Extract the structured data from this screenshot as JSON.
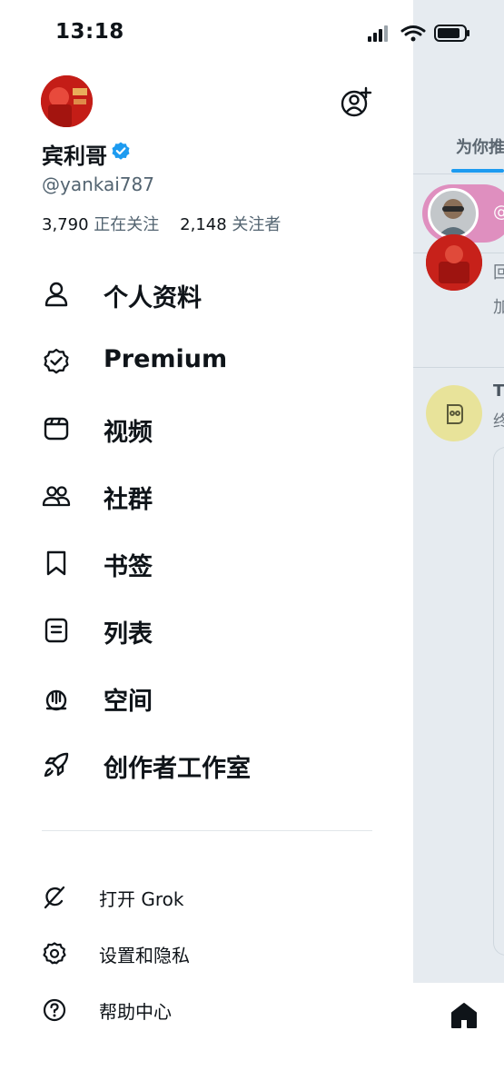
{
  "status_bar": {
    "time": "13:18"
  },
  "profile": {
    "display_name": "宾利哥",
    "handle": "@yankai787",
    "following_count": "3,790",
    "following_label": "正在关注",
    "followers_count": "2,148",
    "followers_label": "关注者"
  },
  "menu": {
    "items": [
      {
        "label": "个人资料",
        "icon": "person-icon"
      },
      {
        "label": "Premium",
        "icon": "premium-badge-icon"
      },
      {
        "label": "视频",
        "icon": "video-icon"
      },
      {
        "label": "社群",
        "icon": "communities-icon"
      },
      {
        "label": "书签",
        "icon": "bookmark-icon"
      },
      {
        "label": "列表",
        "icon": "list-icon"
      },
      {
        "label": "空间",
        "icon": "spaces-icon"
      },
      {
        "label": "创作者工作室",
        "icon": "rocket-icon"
      }
    ]
  },
  "sub_menu": {
    "items": [
      {
        "label": "打开 Grok",
        "icon": "grok-icon"
      },
      {
        "label": "设置和隐私",
        "icon": "gear-icon"
      },
      {
        "label": "帮助中心",
        "icon": "help-icon"
      }
    ]
  },
  "background": {
    "tab_label": "为你推",
    "pill_text": "@",
    "post1_line1": "回",
    "post1_line2": "加",
    "post2_line1": "T",
    "post2_line2": "终"
  },
  "colors": {
    "verified_blue": "#1d9bf0",
    "text_primary": "#0f1419",
    "text_secondary": "#536471"
  }
}
